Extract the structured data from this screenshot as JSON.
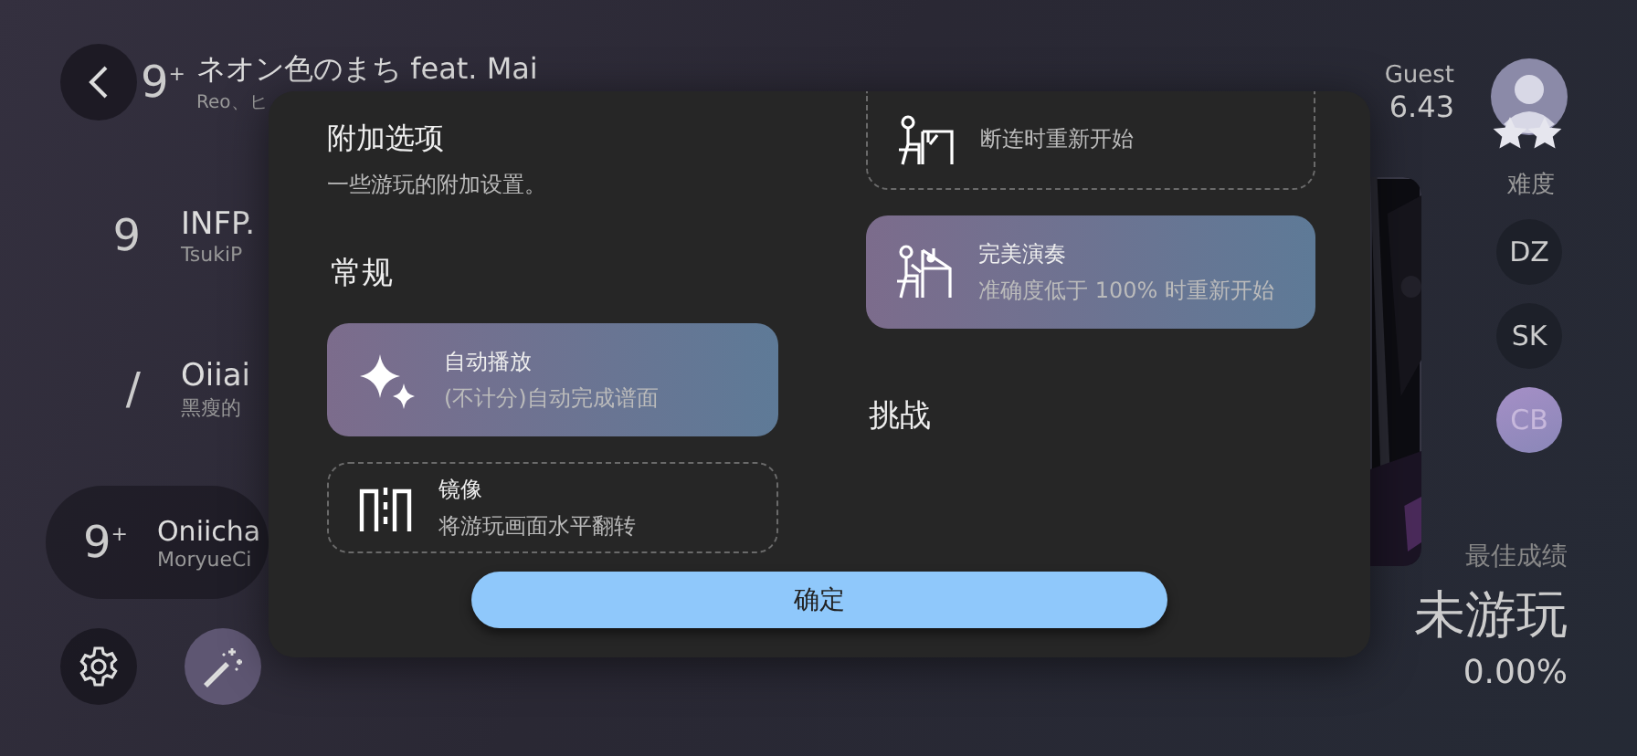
{
  "song_list": [
    {
      "rating": "9$^{+}$",
      "title": "ネオン色のまち feat. Mai",
      "artist": "Reo、ヒ",
      "selected": false
    },
    {
      "rating": "9",
      "title": "INFP.",
      "artist": "TsukiP",
      "selected": false
    },
    {
      "rating": "/",
      "title": "Oiiai",
      "artist": "黑瘦的",
      "selected": false
    },
    {
      "rating": "9$^{+}$",
      "title": "Oniicha",
      "artist": "MoryueCi",
      "selected": true
    }
  ],
  "player": {
    "name": "Guest",
    "rating": "6.43"
  },
  "difficulty": {
    "label": "难度",
    "levels": [
      {
        "label": "DZ",
        "selected": false
      },
      {
        "label": "SK",
        "selected": false
      },
      {
        "label": "CB",
        "selected": true
      }
    ]
  },
  "best": {
    "label": "最佳成绩",
    "status": "未游玩",
    "accuracy": "0.00%"
  },
  "dialog": {
    "title": "附加选项",
    "subtitle": "一些游玩的附加设置。",
    "columns": [
      {
        "items": [
          {
            "kind": "section",
            "title": "常规"
          },
          {
            "kind": "option",
            "title": "自动播放",
            "description": "(不计分)自动完成谱面",
            "selected": true
          },
          {
            "kind": "option",
            "title": "镜像",
            "description": "将游玩画面水平翻转",
            "selected": false
          }
        ]
      },
      {
        "items": [
          {
            "kind": "option",
            "description": "断连时重新开始",
            "selected": false
          },
          {
            "kind": "option",
            "title": "完美演奏",
            "description": "准确度低于 100% 时重新开始",
            "selected": true
          },
          {
            "kind": "section",
            "title": "挑战"
          }
        ]
      }
    ],
    "confirm": "确定"
  }
}
